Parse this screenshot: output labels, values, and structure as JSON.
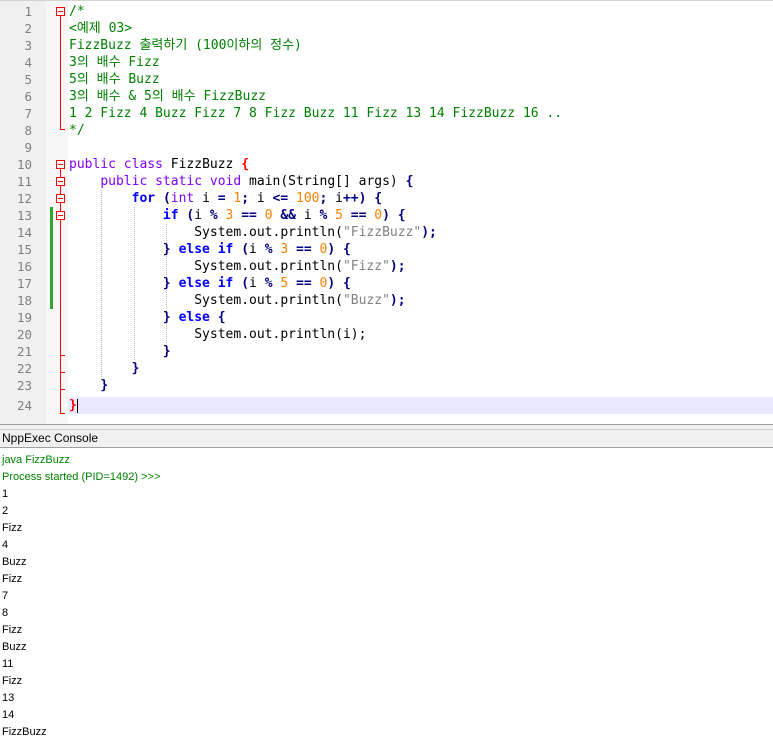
{
  "editor": {
    "line_numbers": [
      "1",
      "2",
      "3",
      "4",
      "5",
      "6",
      "7",
      "8",
      "9",
      "10",
      "11",
      "12",
      "13",
      "14",
      "15",
      "16",
      "17",
      "18",
      "19",
      "20",
      "21",
      "22",
      "23",
      "24"
    ],
    "comment": [
      "/*",
      "<예제 03>",
      "FizzBuzz 출력하기 (100이하의 정수)",
      "3의 배수 Fizz",
      "5의 배수 Buzz",
      "3의 배수 & 5의 배수 FizzBuzz",
      "1 2 Fizz 4 Buzz Fizz 7 8 Fizz Buzz 11 Fizz 13 14 FizzBuzz 16 ..",
      "*/"
    ],
    "code": {
      "kw_public": "public",
      "kw_class": "class",
      "class_name": "FizzBuzz",
      "kw_static": "static",
      "kw_void": "void",
      "method_sig": "main(String[] args)",
      "kw_for": "for",
      "kw_int": "int",
      "kw_if": "if",
      "kw_else": "else",
      "num_0": "0",
      "num_1": "1",
      "num_3": "3",
      "num_5": "5",
      "num_100": "100",
      "println": "System.out.println(",
      "str_fizzbuzz": "\"FizzBuzz\"",
      "str_fizz": "\"Fizz\"",
      "str_buzz": "\"Buzz\"",
      "println_i": "System.out.println(i);"
    }
  },
  "console": {
    "title": "NppExec Console",
    "command": "java FizzBuzz",
    "process_line": "Process started (PID=1492) >>>",
    "output": [
      "1",
      "2",
      "Fizz",
      "4",
      "Buzz",
      "Fizz",
      "7",
      "8",
      "Fizz",
      "Buzz",
      "11",
      "Fizz",
      "13",
      "14",
      "FizzBuzz"
    ]
  },
  "colors": {
    "comment": "#008000",
    "keyword": "#0000ff",
    "type": "#8000ff",
    "number": "#ff8000",
    "string": "#808080",
    "change_marker": "#2fa52f",
    "fold_marker": "#ff0000",
    "current_line": "#e8e8ff"
  }
}
